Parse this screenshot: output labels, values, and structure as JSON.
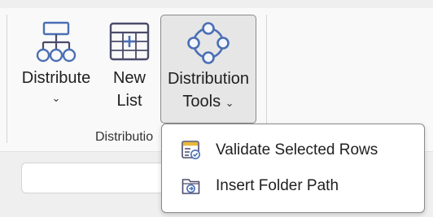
{
  "ribbon": {
    "buttons": [
      {
        "label": "Distribute",
        "has_dropdown": true,
        "icon": "org-chart-icon"
      },
      {
        "label_line1": "New",
        "label_line2": "List",
        "icon": "table-add-icon"
      },
      {
        "label_line1": "Distribution",
        "label_line2": "Tools",
        "has_dropdown": true,
        "selected": true,
        "icon": "distribution-circle-icon"
      }
    ],
    "group_label": "Distributio",
    "chevron": "⌄"
  },
  "menu": {
    "items": [
      {
        "label": "Validate Selected Rows",
        "icon": "validate-rows-icon"
      },
      {
        "label": "Insert Folder Path",
        "icon": "folder-arrow-icon"
      }
    ]
  },
  "colors": {
    "accent_blue": "#4a6fb5",
    "icon_outline": "#4b4b6b",
    "folder_tab": "#e8b93a"
  }
}
